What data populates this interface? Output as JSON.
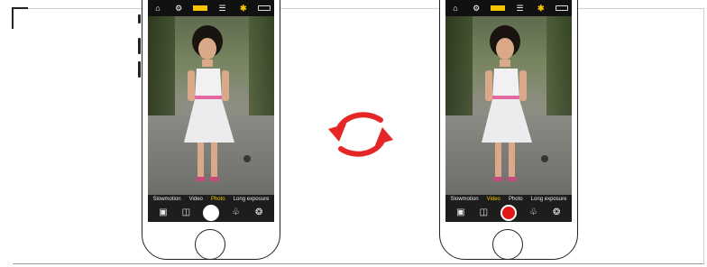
{
  "colors": {
    "accent_yellow": "#f5c400",
    "record_red": "#e21818",
    "swap_red": "#e52626"
  },
  "phones": [
    {
      "id": "left",
      "status_icons": [
        "home-icon",
        "gear-icon",
        "yellow-bar-icon",
        "sliders-icon",
        "bluetooth-icon",
        "battery-icon"
      ],
      "modes": [
        "Slowmotion",
        "Video",
        "Photo",
        "Long exposure"
      ],
      "active_mode": "Photo",
      "shutter": "white"
    },
    {
      "id": "right",
      "status_icons": [
        "home-icon",
        "gear-icon",
        "yellow-bar-icon",
        "sliders-icon",
        "bluetooth-icon",
        "battery-icon"
      ],
      "modes": [
        "Slowmotion",
        "Video",
        "Photo",
        "Long exposure"
      ],
      "active_mode": "Video",
      "shutter": "red"
    }
  ],
  "bluetooth_glyph": "✱"
}
